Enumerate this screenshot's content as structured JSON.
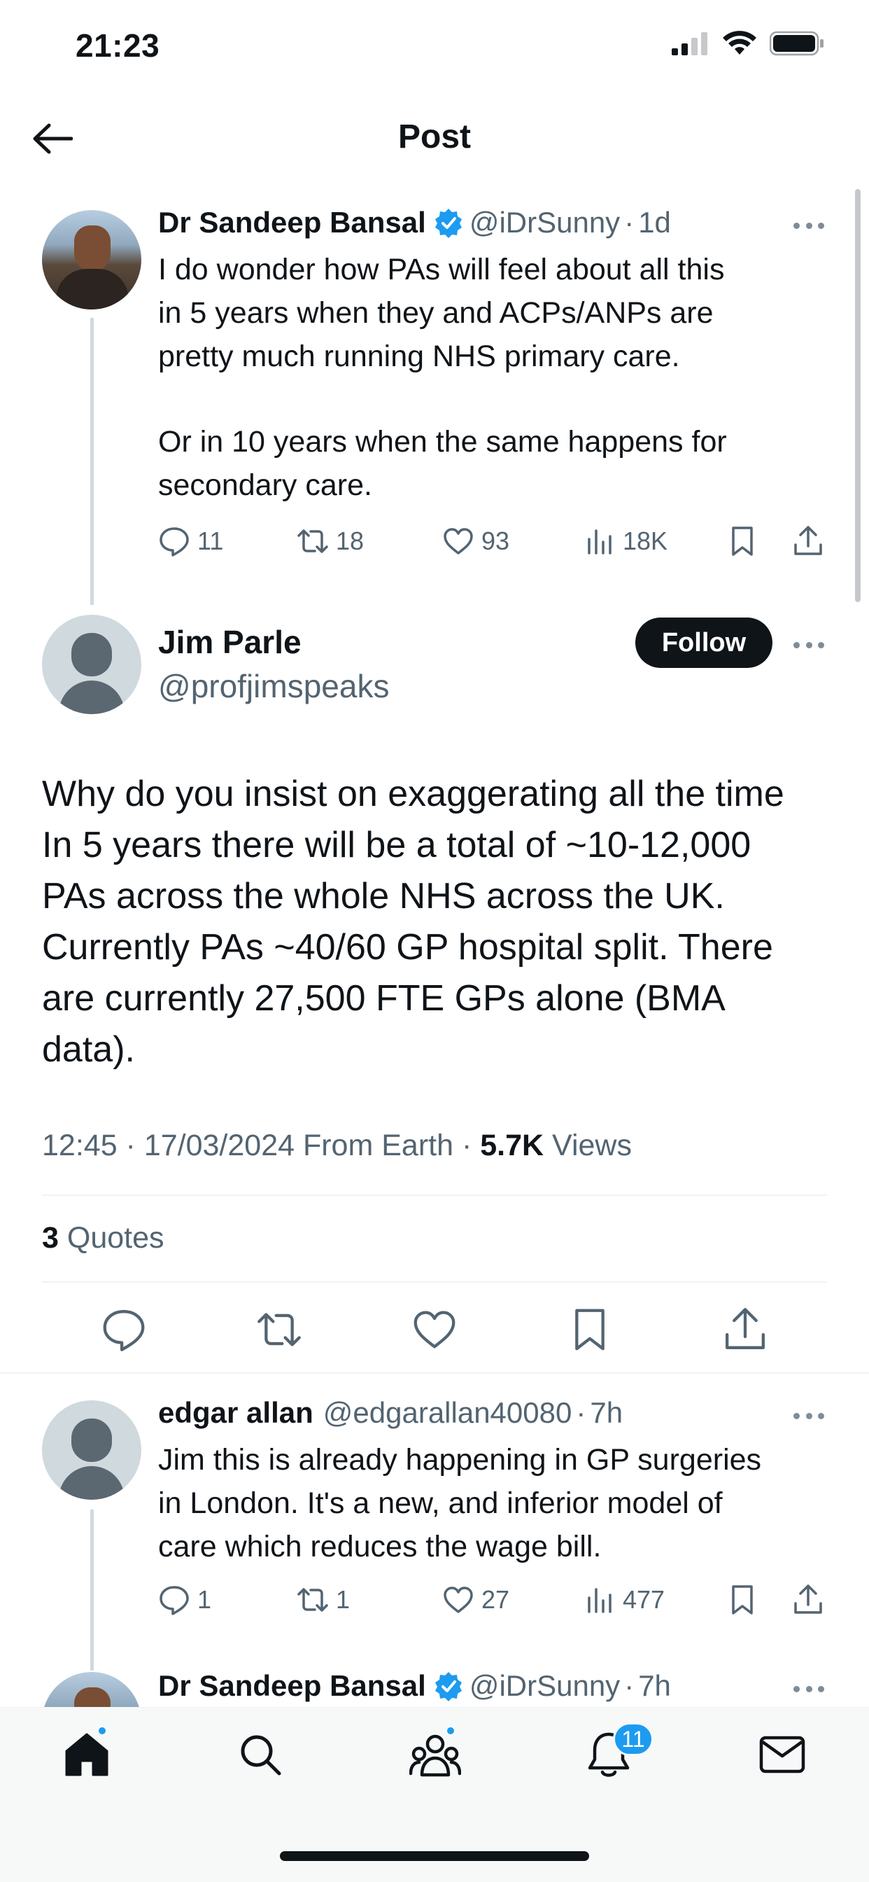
{
  "status_bar": {
    "time": "21:23"
  },
  "header": {
    "title": "Post"
  },
  "parent_tweet": {
    "name": "Dr Sandeep Bansal",
    "handle": "@iDrSunny",
    "sep": "·",
    "time": "1d",
    "text_p1_l1": "I do wonder how PAs will feel about all this",
    "text_p1_l2": "in 5 years when they and ACPs/ANPs are",
    "text_p1_l3": "pretty much running NHS primary care.",
    "text_p2_l1": "Or in 10 years when the same happens for",
    "text_p2_l2": "secondary care.",
    "replies": "11",
    "reposts": "18",
    "likes": "93",
    "views": "18K"
  },
  "main_tweet": {
    "name": "Jim Parle",
    "handle": "@profjimspeaks",
    "follow_label": "Follow",
    "text_l1": "Why do you insist on exaggerating all the time",
    "text_l2": "In 5 years there will be a total of ~10-12,000",
    "text_l3": "PAs across the whole NHS across the UK.",
    "text_l4": "Currently PAs ~40/60 GP hospital split. There",
    "text_l5": "are currently 27,500 FTE GPs alone (BMA",
    "text_l6": "data).",
    "meta_time": "12:45 · 17/03/2024 From Earth ·",
    "meta_views_count": "5.7K",
    "meta_views_label": "Views",
    "quotes_count": "3",
    "quotes_label": "Quotes"
  },
  "reply_tweet": {
    "name": "edgar allan",
    "handle": "@edgarallan40080",
    "sep": "·",
    "time": "7h",
    "text_l1": "Jim this is already happening in GP surgeries",
    "text_l2": "in London. It's a new, and inferior model of",
    "text_l3": "care which reduces the wage bill.",
    "replies": "1",
    "reposts": "1",
    "likes": "27",
    "views": "477"
  },
  "next_tweet": {
    "name": "Dr Sandeep Bansal",
    "handle": "@iDrSunny",
    "sep": "·",
    "time": "7h"
  },
  "bottom_nav": {
    "notifications_badge": "11"
  },
  "colors": {
    "accent": "#1d9bf0",
    "text": "#0f1419",
    "secondary": "#536471"
  }
}
